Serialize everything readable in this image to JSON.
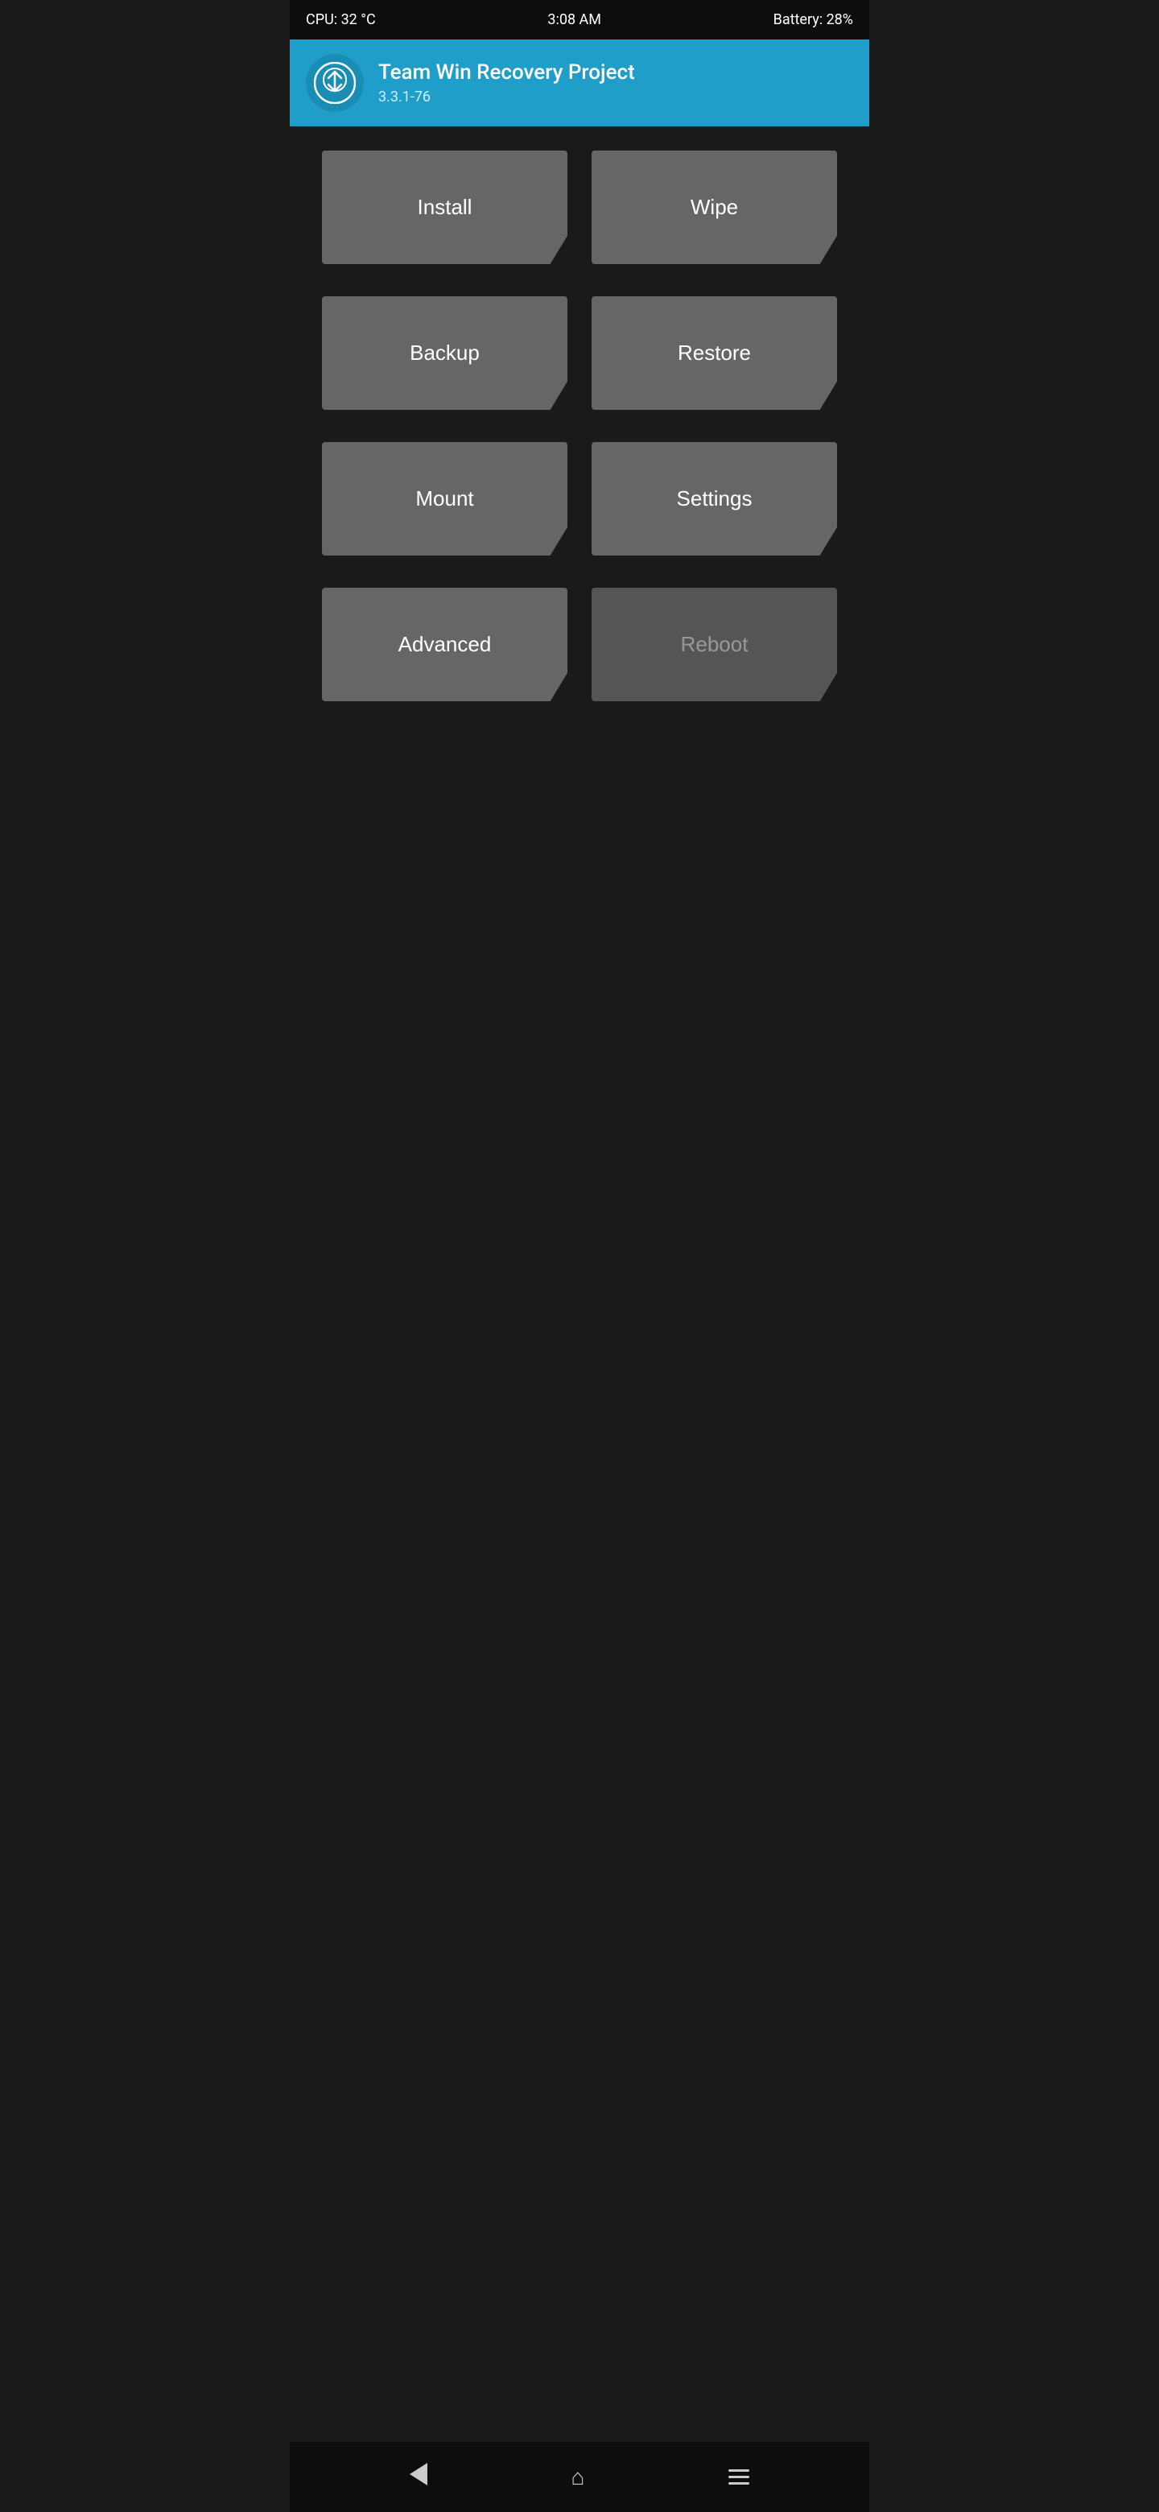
{
  "statusBar": {
    "cpu": "CPU: 32 °C",
    "time": "3:08 AM",
    "battery": "Battery: 28%"
  },
  "header": {
    "title": "Team Win Recovery Project",
    "version": "3.3.1-76",
    "logoAlt": "TWRP Logo"
  },
  "buttons": [
    [
      {
        "id": "install",
        "label": "Install",
        "disabled": false
      },
      {
        "id": "wipe",
        "label": "Wipe",
        "disabled": false
      }
    ],
    [
      {
        "id": "backup",
        "label": "Backup",
        "disabled": false
      },
      {
        "id": "restore",
        "label": "Restore",
        "disabled": false
      }
    ],
    [
      {
        "id": "mount",
        "label": "Mount",
        "disabled": false
      },
      {
        "id": "settings",
        "label": "Settings",
        "disabled": false
      }
    ],
    [
      {
        "id": "advanced",
        "label": "Advanced",
        "disabled": false
      },
      {
        "id": "reboot",
        "label": "Reboot",
        "disabled": true
      }
    ]
  ],
  "navBar": {
    "back": "back",
    "home": "home",
    "menu": "menu"
  },
  "colors": {
    "headerBg": "#1e9ec8",
    "buttonBg": "#666666",
    "buttonDisabledBg": "#555555",
    "bodyBg": "#1a1a1a",
    "statusBg": "#0d0d0d"
  }
}
